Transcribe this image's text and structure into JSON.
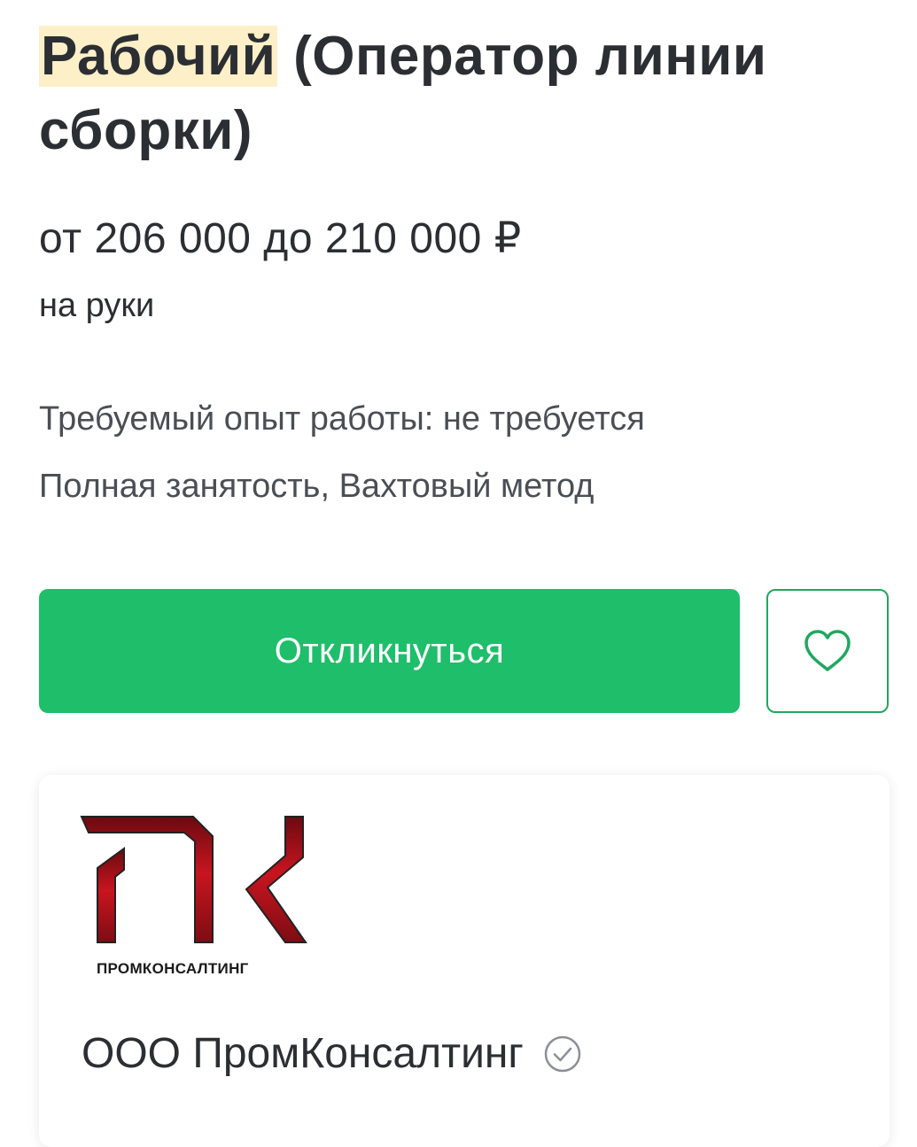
{
  "vacancy": {
    "title_highlight": "Рабочий",
    "title_rest": " (Оператор линии сборки)",
    "salary": "от 206 000 до 210 000 ₽",
    "salary_note": "на руки",
    "experience": "Требуемый опыт работы: не требуется",
    "employment": "Полная занятость, Вахтовый метод"
  },
  "actions": {
    "apply_label": "Откликнуться",
    "favorite_icon": "heart-outline-icon"
  },
  "company": {
    "logo_text": "ПРОМКОНСАЛТИНГ",
    "name": "ООО ПромКонсалтинг",
    "verified_icon": "check-circle-icon"
  },
  "colors": {
    "accent_green": "#1fbe6a",
    "highlight": "#fdefc7",
    "logo_red": "#b3121b"
  }
}
